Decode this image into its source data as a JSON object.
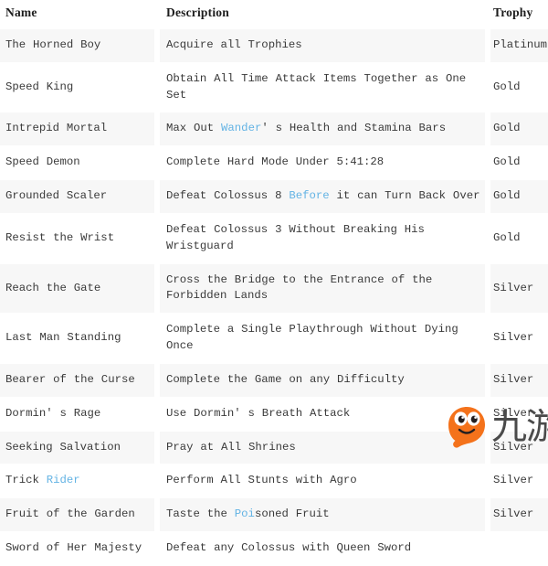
{
  "table": {
    "columns": [
      {
        "key": "name",
        "label": "Name"
      },
      {
        "key": "description",
        "label": "Description"
      },
      {
        "key": "trophy",
        "label": "Trophy"
      }
    ],
    "rows": [
      {
        "name": "The Horned Boy",
        "name_plain": "The Horned Boy",
        "description": "Acquire all Trophies",
        "trophy": "Platinum",
        "shaded": true
      },
      {
        "name": "Speed King",
        "name_plain": "Speed King",
        "description": "Obtain All Time Attack Items Together as One Set",
        "trophy": "Gold",
        "shaded": false
      },
      {
        "name": "Intrepid Mortal",
        "name_plain": "Intrepid Mortal",
        "description": "Max Out Wander' s Health and Stamina Bars",
        "description_highlight": "Wander",
        "trophy": "Gold",
        "shaded": true
      },
      {
        "name": "Speed Demon",
        "name_plain": "Speed Demon",
        "description": "Complete Hard Mode Under 5:41:28",
        "trophy": "Gold",
        "shaded": false
      },
      {
        "name": "Grounded Scaler",
        "name_plain": "Grounded Scaler",
        "description": "Defeat Colossus 8 Before it can Turn Back Over",
        "description_highlight": "Before",
        "trophy": "Gold",
        "shaded": true
      },
      {
        "name": "Resist the Wrist",
        "name_plain": "Resist the Wrist",
        "description": "Defeat Colossus 3 Without Breaking His Wristguard",
        "trophy": "Gold",
        "shaded": false
      },
      {
        "name": "Reach the Gate",
        "name_plain": "Reach the Gate",
        "description": "Cross the Bridge to the Entrance of the Forbidden Lands",
        "trophy": "Silver",
        "shaded": true
      },
      {
        "name": "Last Man Standing",
        "name_plain": "Last Man Standing",
        "description": "Complete a Single Playthrough Without Dying Once",
        "trophy": "Silver",
        "shaded": false
      },
      {
        "name": "Bearer of the Curse",
        "name_plain": "Bearer of the Curse",
        "description": "Complete the Game on any Difficulty",
        "trophy": "Silver",
        "shaded": true
      },
      {
        "name": "Dormin' s Rage",
        "name_plain": "Dormin' s Rage",
        "description": "Use Dormin' s Breath Attack",
        "trophy": "Silver",
        "shaded": false
      },
      {
        "name": "Seeking Salvation",
        "name_plain": "Seeking Salvation",
        "description": "Pray at All Shrines",
        "trophy": "Silver",
        "shaded": true
      },
      {
        "name": "Trick Rider",
        "name_plain": "Trick Rider",
        "name_highlight": "Rider",
        "description": "Perform All Stunts with Agro",
        "trophy": "Silver",
        "shaded": false
      },
      {
        "name": "Fruit of the Garden",
        "name_plain": "Fruit of the Garden",
        "description": "Taste the Poisoned Fruit",
        "description_highlight": "Poi",
        "trophy": "Silver",
        "shaded": true
      },
      {
        "name": "Sword of Her Majesty",
        "name_plain": "Sword of Her Majesty",
        "description": "Defeat any Colossus with Queen Sword",
        "trophy": "",
        "shaded": false
      }
    ]
  },
  "watermark": {
    "text": "九游",
    "mascot_color": "#f4721b",
    "text_color": "#4a4a4a"
  },
  "colors": {
    "highlight": "#63b3e4",
    "row_shaded": "#f7f7f7",
    "row_plain": "#ffffff",
    "text": "#3a3a3a",
    "header_text": "#1d1d1d"
  }
}
